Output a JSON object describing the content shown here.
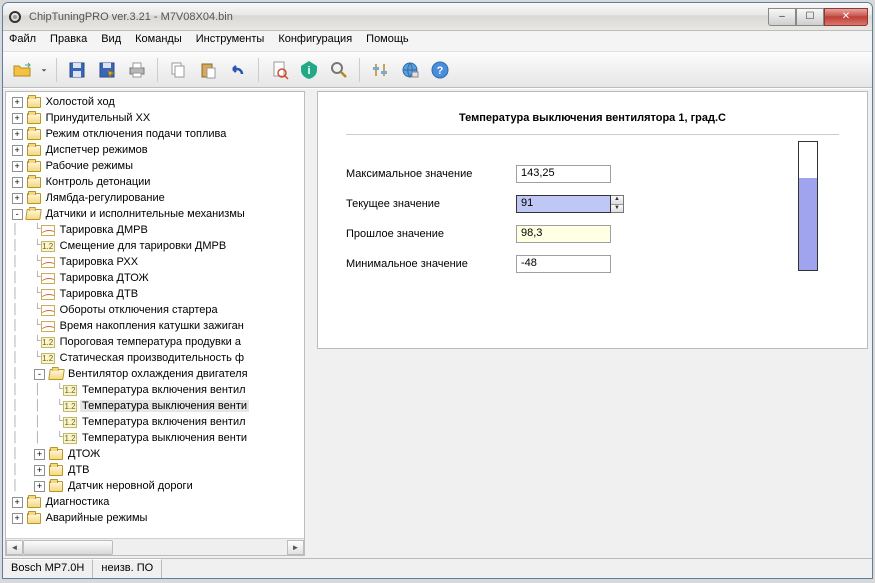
{
  "window": {
    "title": "ChipTuningPRO ver.3.21 - M7V08X04.bin"
  },
  "menu": [
    "Файл",
    "Правка",
    "Вид",
    "Команды",
    "Инструменты",
    "Конфигурация",
    "Помощь"
  ],
  "tree": [
    {
      "t": "f",
      "exp": "+",
      "d": 0,
      "l": "Холостой ход"
    },
    {
      "t": "f",
      "exp": "+",
      "d": 0,
      "l": "Принудительный ХХ"
    },
    {
      "t": "f",
      "exp": "+",
      "d": 0,
      "l": "Режим отключения подачи топлива"
    },
    {
      "t": "f",
      "exp": "+",
      "d": 0,
      "l": "Диспетчер режимов"
    },
    {
      "t": "f",
      "exp": "+",
      "d": 0,
      "l": "Рабочие режимы"
    },
    {
      "t": "f",
      "exp": "+",
      "d": 0,
      "l": "Контроль детонации"
    },
    {
      "t": "f",
      "exp": "+",
      "d": 0,
      "l": "Лямбда-регулирование"
    },
    {
      "t": "fo",
      "exp": "-",
      "d": 0,
      "l": "Датчики и исполнительные механизмы"
    },
    {
      "t": "w",
      "d": 1,
      "l": "Тарировка ДМРВ"
    },
    {
      "t": "12",
      "d": 1,
      "l": "Смещение для тарировки ДМРВ"
    },
    {
      "t": "w",
      "d": 1,
      "l": "Тарировка РХХ"
    },
    {
      "t": "w",
      "d": 1,
      "l": "Тарировка ДТОЖ"
    },
    {
      "t": "w",
      "d": 1,
      "l": "Тарировка ДТВ"
    },
    {
      "t": "w",
      "d": 1,
      "l": "Обороты отключения стартера"
    },
    {
      "t": "w",
      "d": 1,
      "l": "Время накопления катушки зажиган"
    },
    {
      "t": "12",
      "d": 1,
      "l": "Пороговая температура продувки а"
    },
    {
      "t": "12",
      "d": 1,
      "l": "Статическая производительность ф"
    },
    {
      "t": "fo",
      "exp": "-",
      "d": 1,
      "l": "Вентилятор охлаждения двигателя"
    },
    {
      "t": "12",
      "d": 2,
      "l": "Температура включения вентил"
    },
    {
      "t": "12",
      "d": 2,
      "l": "Температура выключения венти",
      "sel": true
    },
    {
      "t": "12",
      "d": 2,
      "l": "Температура включения вентил"
    },
    {
      "t": "12",
      "d": 2,
      "l": "Температура выключения венти"
    },
    {
      "t": "f",
      "exp": "+",
      "d": 1,
      "l": "ДТОЖ"
    },
    {
      "t": "f",
      "exp": "+",
      "d": 1,
      "l": "ДТВ"
    },
    {
      "t": "f",
      "exp": "+",
      "d": 1,
      "l": "Датчик неровной дороги"
    },
    {
      "t": "f",
      "exp": "+",
      "d": 0,
      "l": "Диагностика"
    },
    {
      "t": "f",
      "exp": "+",
      "d": 0,
      "l": "Аварийные режимы"
    }
  ],
  "panel": {
    "title": "Температура выключения вентилятора 1, град.С",
    "rows": {
      "max_l": "Максимальное значение",
      "max_v": "143,25",
      "cur_l": "Текущее значение",
      "cur_v": "91",
      "past_l": "Прошлое значение",
      "past_v": "98,3",
      "min_l": "Минимальное значение",
      "min_v": "-48"
    }
  },
  "status": {
    "a": "Bosch MP7.0H",
    "b": "неизв. ПО"
  }
}
